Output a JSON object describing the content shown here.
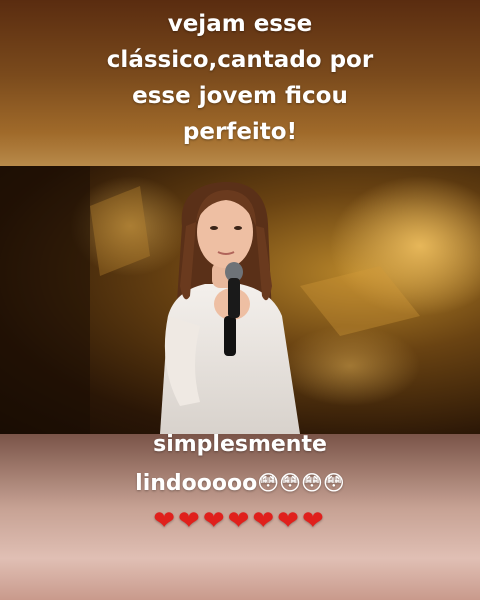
{
  "caption_top": {
    "line1": "vejam esse",
    "line2": "clássico,cantado por",
    "line3": "esse jovem ficou",
    "line4": "perfeito!"
  },
  "caption_bottom": {
    "line1": "simplesmente",
    "line2_text": "lindooooo",
    "line2_emojis": "😳😳😳😳",
    "hearts": "❤❤❤❤❤❤❤"
  },
  "colors": {
    "caption_text": "#ffffff",
    "heart": "#e0201c",
    "stage_gold": "#b8862a"
  },
  "video": {
    "subject": "girl-singing-with-microphone",
    "icons": [
      "microphone-icon"
    ]
  }
}
